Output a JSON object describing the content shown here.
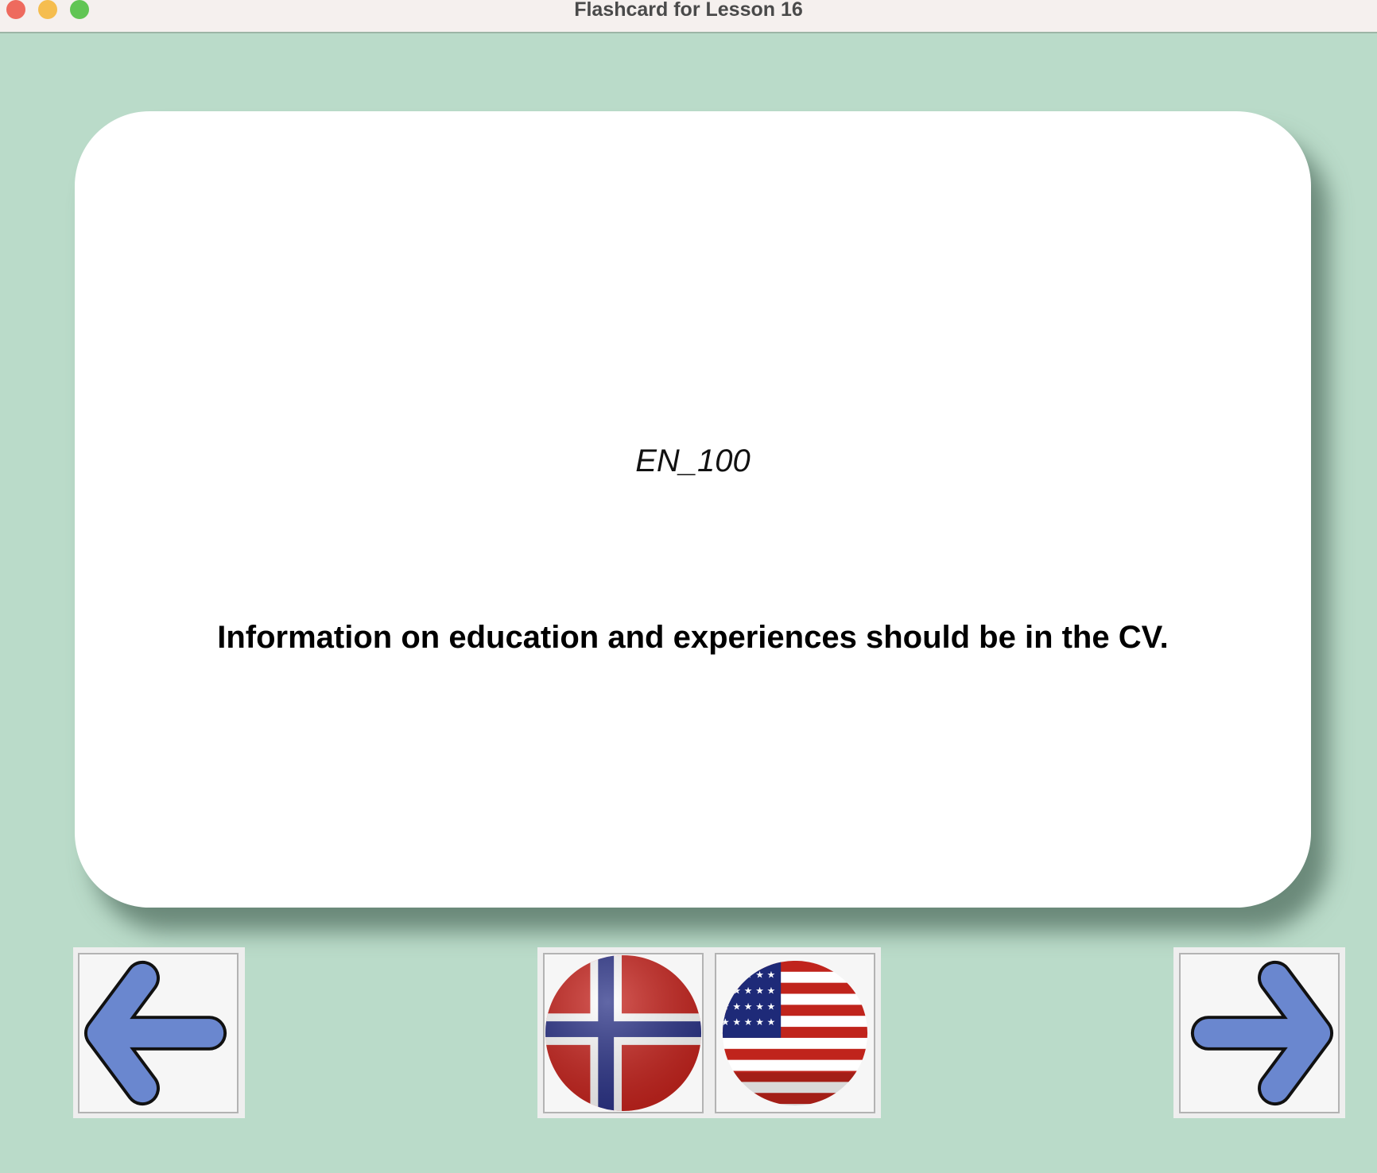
{
  "window": {
    "title": "Flashcard for Lesson 16"
  },
  "card": {
    "code": "EN_100",
    "sentence": "Information on education and experiences should be in the CV."
  },
  "colors": {
    "background": "#badbc9",
    "arrow": "#6a87cf",
    "norway_red": "#c8251f",
    "norway_blue": "#2d3589"
  },
  "controls": {
    "prev_icon": "arrow-left-icon",
    "next_icon": "arrow-right-icon",
    "norwegian_flag": "norway-flag-icon",
    "english_flag": "usa-flag-icon"
  }
}
